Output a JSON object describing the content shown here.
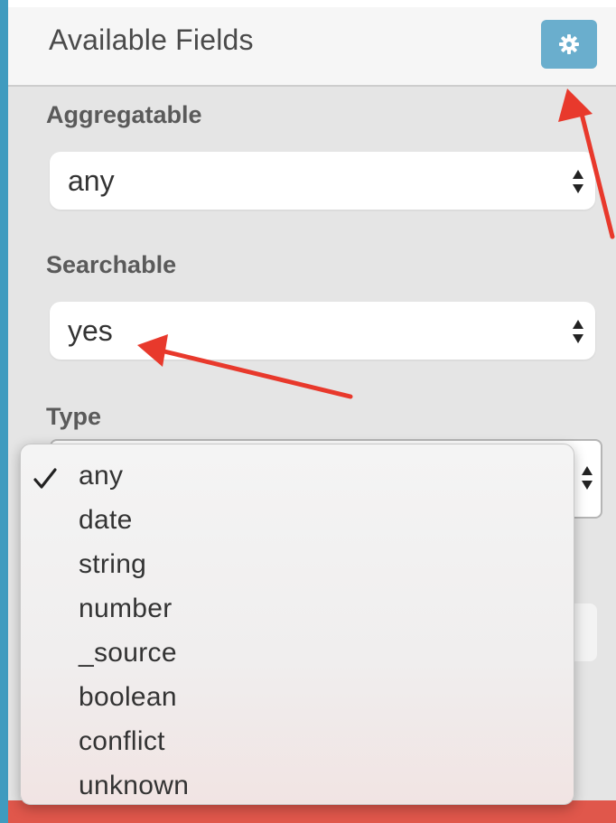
{
  "header": {
    "title": "Available Fields",
    "settings_icon": "gear-icon"
  },
  "filters": {
    "aggregatable": {
      "label": "Aggregatable",
      "value": "any"
    },
    "searchable": {
      "label": "Searchable",
      "value": "yes"
    },
    "type": {
      "label": "Type",
      "selected": "any",
      "options": [
        "any",
        "date",
        "string",
        "number",
        "_source",
        "boolean",
        "conflict",
        "unknown"
      ]
    }
  },
  "colors": {
    "accent_bar": "#3f9bbf",
    "gear_button": "#6aaecd",
    "annotation_arrow": "#e8392c",
    "footer_strip": "#e0574b"
  }
}
